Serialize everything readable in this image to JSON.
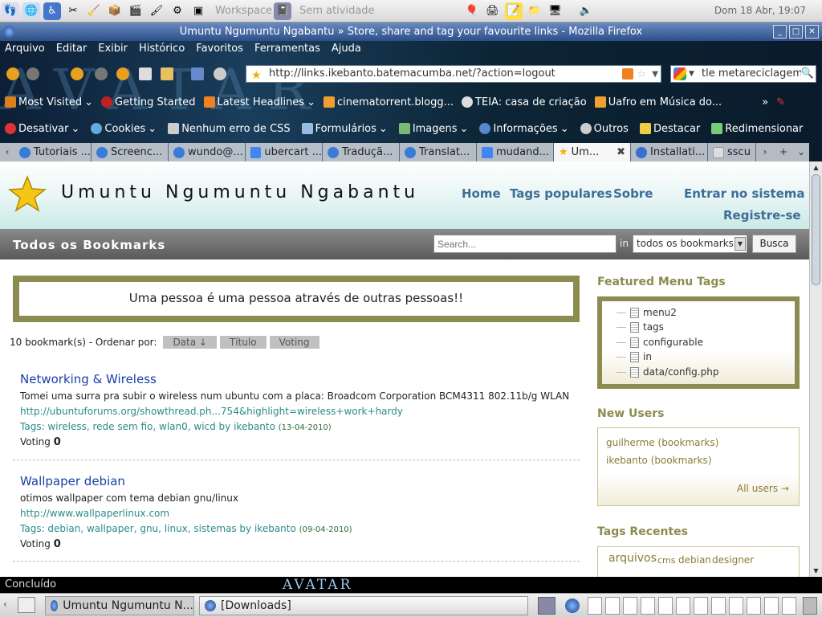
{
  "panel": {
    "workspace_label": "Workspace",
    "activity": "Sem atividade",
    "clock": "Dom 18 Abr, 19:07"
  },
  "window": {
    "title": "Umuntu Ngumuntu Ngabantu » Store, share and tag your favourite links - Mozilla Firefox"
  },
  "menu": [
    "Arquivo",
    "Editar",
    "Exibir",
    "Histórico",
    "Favoritos",
    "Ferramentas",
    "Ajuda"
  ],
  "urlbar": {
    "url": "http://links.ikebanto.batemacumba.net/?action=logout"
  },
  "searchbar": {
    "value": "tle metareciclagem"
  },
  "bookmarks": [
    "Most Visited",
    "Getting Started",
    "Latest Headlines",
    "cinematorrent.blogg...",
    "TEIA: casa de criação",
    "Uafro em Música do..."
  ],
  "webdev": [
    "Desativar",
    "Cookies",
    "Nenhum erro de CSS",
    "Formulários",
    "Imagens",
    "Informações",
    "Outros",
    "Destacar",
    "Redimensionar"
  ],
  "tabs": [
    "Tutoriais ...",
    "Screenc...",
    "wundo@...",
    "ubercart ...",
    "Traduçã...",
    "Translat...",
    "mudand...",
    "Um...",
    "Installati...",
    "sscu"
  ],
  "site": {
    "title": "Umuntu Ngumuntu Ngabantu",
    "nav": {
      "home": "Home",
      "tags": "Tags populares",
      "about": "Sobre",
      "login": "Entrar no sistema",
      "register": "Registre-se"
    },
    "subbar_title": "Todos os Bookmarks",
    "search_placeholder": "Search...",
    "in_label": "in",
    "scope": "todos os bookmarks",
    "search_button": "Busca",
    "quote": "Uma pessoa é uma pessoa através de outras pessoas!!",
    "count_label": "10 bookmark(s) - Ordenar por:",
    "sort": {
      "date": "Data ↓",
      "title": "Título",
      "voting": "Voting"
    }
  },
  "items": [
    {
      "title": "Networking & Wireless",
      "desc": "Tomei uma surra pra subir o wireless num ubuntu com a placa: Broadcom Corporation BCM4311 802.11b/g WLAN",
      "url": "http://ubuntuforums.org/showthread.ph...754&highlight=wireless+work+hardy",
      "tags": "Tags: wireless, rede sem fio, wlan0, wicd by ikebanto",
      "date": "(13-04-2010)",
      "voting_label": "Voting",
      "voting": "0"
    },
    {
      "title": "Wallpaper debian",
      "desc": "otimos wallpaper com tema debian gnu/linux",
      "url": "http://www.wallpaperlinux.com",
      "tags": "Tags: debian, wallpaper, gnu, linux, sistemas by ikebanto",
      "date": "(09-04-2010)",
      "voting_label": "Voting",
      "voting": "0"
    }
  ],
  "sidebar": {
    "featured_title": "Featured Menu Tags",
    "featured": [
      "menu2",
      "tags",
      "configurable",
      "in",
      "data/config.php"
    ],
    "users_title": "New Users",
    "users": [
      {
        "name": "guilherme",
        "link": "bookmarks"
      },
      {
        "name": "ikebanto",
        "link": "bookmarks"
      }
    ],
    "all_users": "All users →",
    "recent_title": "Tags Recentes",
    "recent": [
      "arquivos",
      "cms",
      "debian",
      "designer"
    ]
  },
  "status": {
    "text": "Concluído",
    "logo": "AVATAR"
  },
  "taskbar": [
    {
      "label": "Umuntu Ngumuntu N..."
    },
    {
      "label": "[Downloads]"
    }
  ],
  "colors": {
    "link": "#1a3ea8",
    "accent_olive": "#8c8c50",
    "nav_blue": "#3d6d99",
    "url_teal": "#2b8a8a"
  }
}
